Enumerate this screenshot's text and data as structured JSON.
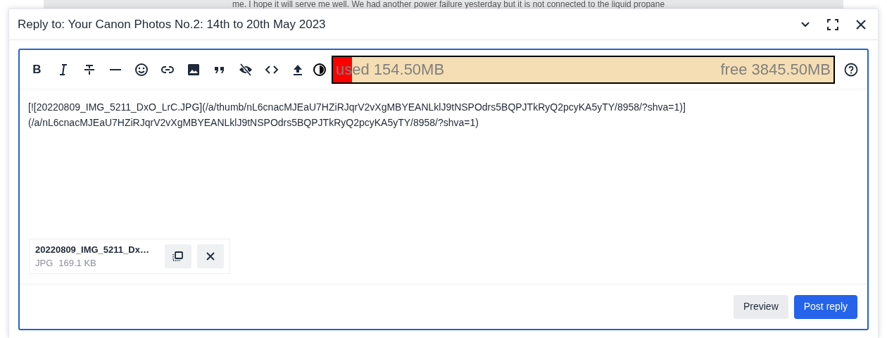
{
  "background_text": "me. I hope it will serve me well. We had another power failure yesterday but it is not connected to the liquid propane",
  "dialog": {
    "title": "Reply to: Your Canon Photos No.2: 14th to 20th May 2023"
  },
  "toolbar": {
    "tools": [
      {
        "kind": "bold",
        "label": "B"
      },
      {
        "kind": "italic"
      },
      {
        "kind": "strike"
      },
      {
        "kind": "rule"
      },
      {
        "kind": "emoji"
      },
      {
        "kind": "link"
      },
      {
        "kind": "image"
      },
      {
        "kind": "quote"
      },
      {
        "kind": "hide"
      },
      {
        "kind": "code"
      },
      {
        "kind": "upload"
      },
      {
        "kind": "contrast"
      }
    ],
    "storage": {
      "used": "used 154.50MB",
      "free": "free 3845.50MB",
      "level": 0.0386
    }
  },
  "editor": {
    "value": "[![20220809_IMG_5211_DxO_LrC.JPG](/a/thumb/nL6cnacMJEaU7HZiRJqrV2vXgMBYEANLklJ9tNSPOdrs5BQPJTkRyQ2pcyKA5yTY/8958/?shva=1)](/a/nL6cnacMJEaU7HZiRJqrV2vXgMBYEANLklJ9tNSPOdrs5BQPJTkRyQ2pcyKA5yTY/8958/?shva=1)"
  },
  "attachments": [
    {
      "name": "20220809_IMG_5211_Dx…",
      "type": "JPG",
      "size": "169.1 KB"
    }
  ],
  "buttons": [
    {
      "label": "Preview",
      "kind": "secondary"
    },
    {
      "label": "Post reply",
      "kind": "primary"
    }
  ]
}
